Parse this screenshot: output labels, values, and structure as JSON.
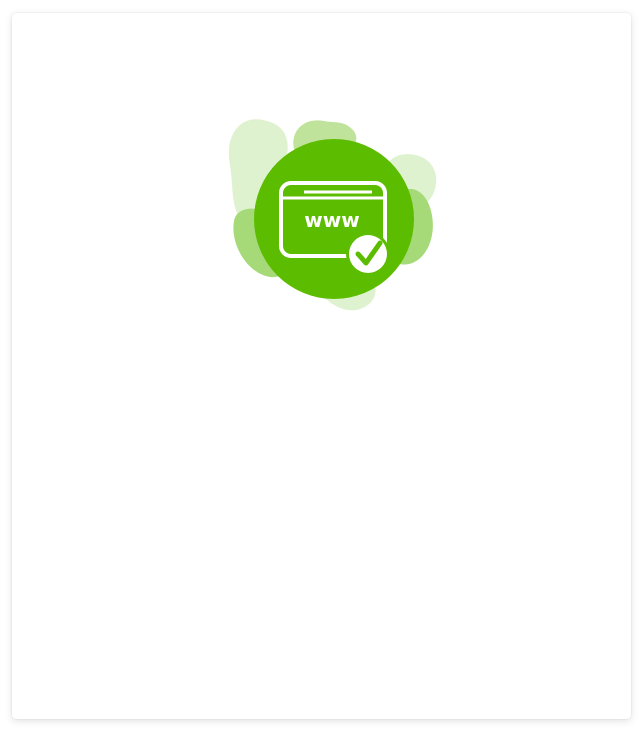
{
  "illustration": {
    "icon": "www-check-icon",
    "label": "www",
    "colors": {
      "primary": "#5cbd00",
      "blob_light": "#dff2cf",
      "blob_mid": "#bfe39a",
      "blob_dark": "#a6d978",
      "foreground": "#ffffff"
    }
  }
}
